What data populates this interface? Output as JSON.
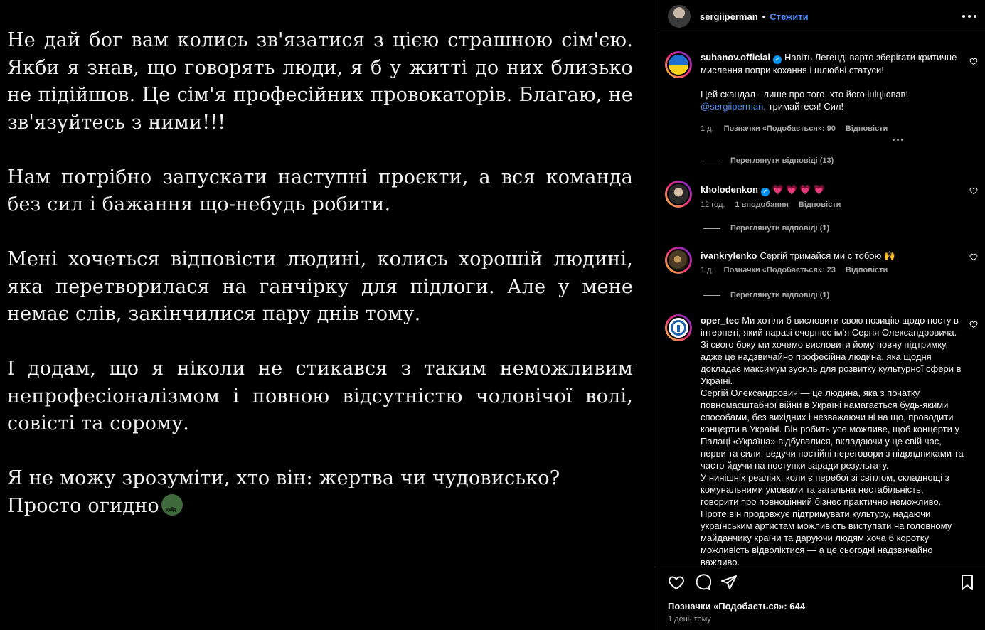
{
  "post_image": {
    "paragraphs": [
      "Не дай бог вам колись зв'язатися з цією страшною сім'єю. Якби я знав, що говорять люди, я б у житті до них близько не підійшов. Це сім'я професійних провокаторів. Благаю, не зв'язуйтесь з ними!!!",
      "Нам потрібно запускати наступні проєкти, а вся команда без сил і бажання що-небудь робити.",
      "Мені хочеться відповісти людині, колись хорошій людині, яка перетворилася на ганчірку для підлоги. Але у мене немає слів, закінчилися пару днів тому.",
      "І додам, що я ніколи не стикався з таким неможливим непрофесіоналізмом і повною відсутністю чоловічої волі, совісті та сорому."
    ],
    "last_line_1": "Я не можу зрозуміти, хто він: жертва чи чудовисько?",
    "last_line_2": "Просто огидно",
    "last_emoji": "nauseated-face-icon"
  },
  "header": {
    "username": "sergiiperman",
    "separator": "•",
    "follow_label": "Стежити"
  },
  "comments": [
    {
      "username": "suhanov.official",
      "verified": true,
      "text_1": "Навіть Легенді варто зберігати критичне мислення попри кохання і шлюбні статуси!",
      "text_2": "Цей скандал - лише про того, хто його ініціював!",
      "mention": "@sergiiperman",
      "text_3": ", тримайтеся! Сил!",
      "time": "1 д.",
      "likes": "Позначки «Подобається»: 90",
      "reply": "Відповісти",
      "view_replies": "Переглянути відповіді (13)"
    },
    {
      "username": "kholodenkon",
      "verified": true,
      "text": "💗💗💗💗",
      "time": "12 год.",
      "likes": "1 вподобання",
      "reply": "Відповісти",
      "view_replies": "Переглянути відповіді (1)"
    },
    {
      "username": "ivankrylenko",
      "verified": false,
      "text": "Сергій тримайся ми с тобою",
      "emoji": "🙌",
      "time": "1 д.",
      "likes": "Позначки «Подобається»: 23",
      "reply": "Відповісти",
      "view_replies": "Переглянути відповіді (1)"
    },
    {
      "username": "oper_tec",
      "verified": false,
      "p1": "Ми хотіли б висловити свою позицію щодо посту в інтернеті, який наразі очорнює ім'я Сергія Олександровича. Зі свого боку ми хочемо висловити йому повну підтримку, адже це надзвичайно професійна людина, яка щодня докладає максимум зусиль для розвитку культурної сфери в Україні.",
      "p2": "Сергій Олександрович — це людина, яка з початку повномасштабної війни в Україні намагається будь-якими способами, без вихідних і незважаючи ні на що, проводити концерти в Україні. Він робить усе можливе, щоб концерти у Палаці «Україна» відбувалися, вкладаючи у це свій час, нерви та сили, ведучи постійні переговори з підрядниками та часто йдучи на поступки заради результату.",
      "p3": "У нинішніх реаліях, коли є перебої зі світлом, складнощі з комунальними умовами та загальна нестабільність, говорити про повноцінний бізнес практично неможливо.",
      "p4": "Проте він продовжує підтримувати культуру, надаючи українським артистам можливість виступати на головному майданчику країни та даруючи людям хоча б коротку можливість відволіктися — а це сьогодні надзвичайно важливо."
    }
  ],
  "footer": {
    "likes": "Позначки «Подобається»: 644",
    "time": "1 день тому"
  },
  "colors": {
    "background": "#000000",
    "link_blue": "#4e8cf3",
    "muted": "#a8a8a8",
    "border": "#262626"
  }
}
